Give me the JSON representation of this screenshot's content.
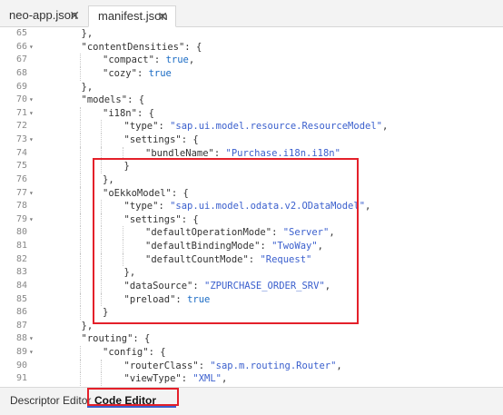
{
  "tabs": [
    {
      "label": "neo-app.json",
      "close": "✕"
    },
    {
      "label": "manifest.json",
      "close": "✕"
    }
  ],
  "lines": [
    {
      "n": "65",
      "fold": "",
      "indent": 1,
      "tokens": [
        [
          "p",
          "},"
        ]
      ]
    },
    {
      "n": "66",
      "fold": "▾",
      "indent": 1,
      "tokens": [
        [
          "k",
          "\"contentDensities\""
        ],
        [
          "p",
          ": {"
        ]
      ]
    },
    {
      "n": "67",
      "fold": "",
      "indent": 2,
      "tokens": [
        [
          "k",
          "\"compact\""
        ],
        [
          "p",
          ": "
        ],
        [
          "w",
          "true"
        ],
        [
          "p",
          ","
        ]
      ]
    },
    {
      "n": "68",
      "fold": "",
      "indent": 2,
      "tokens": [
        [
          "k",
          "\"cozy\""
        ],
        [
          "p",
          ": "
        ],
        [
          "w",
          "true"
        ]
      ]
    },
    {
      "n": "69",
      "fold": "",
      "indent": 1,
      "tokens": [
        [
          "p",
          "},"
        ]
      ]
    },
    {
      "n": "70",
      "fold": "▾",
      "indent": 1,
      "tokens": [
        [
          "k",
          "\"models\""
        ],
        [
          "p",
          ": {"
        ]
      ]
    },
    {
      "n": "71",
      "fold": "▾",
      "indent": 2,
      "tokens": [
        [
          "k",
          "\"i18n\""
        ],
        [
          "p",
          ": {"
        ]
      ]
    },
    {
      "n": "72",
      "fold": "",
      "indent": 3,
      "tokens": [
        [
          "k",
          "\"type\""
        ],
        [
          "p",
          ": "
        ],
        [
          "s",
          "\"sap.ui.model.resource.ResourceModel\""
        ],
        [
          "p",
          ","
        ]
      ]
    },
    {
      "n": "73",
      "fold": "▾",
      "indent": 3,
      "tokens": [
        [
          "k",
          "\"settings\""
        ],
        [
          "p",
          ": {"
        ]
      ]
    },
    {
      "n": "74",
      "fold": "",
      "indent": 4,
      "tokens": [
        [
          "k",
          "\"bundleName\""
        ],
        [
          "p",
          ": "
        ],
        [
          "s",
          "\"Purchase.i18n.i18n\""
        ]
      ]
    },
    {
      "n": "75",
      "fold": "",
      "indent": 3,
      "tokens": [
        [
          "p",
          "}"
        ]
      ]
    },
    {
      "n": "76",
      "fold": "",
      "indent": 2,
      "tokens": [
        [
          "p",
          "},"
        ]
      ]
    },
    {
      "n": "77",
      "fold": "▾",
      "indent": 2,
      "tokens": [
        [
          "k",
          "\"oEkkoModel\""
        ],
        [
          "p",
          ": {"
        ]
      ]
    },
    {
      "n": "78",
      "fold": "",
      "indent": 3,
      "tokens": [
        [
          "k",
          "\"type\""
        ],
        [
          "p",
          ": "
        ],
        [
          "s",
          "\"sap.ui.model.odata.v2.ODataModel\""
        ],
        [
          "p",
          ","
        ]
      ]
    },
    {
      "n": "79",
      "fold": "▾",
      "indent": 3,
      "tokens": [
        [
          "k",
          "\"settings\""
        ],
        [
          "p",
          ": {"
        ]
      ]
    },
    {
      "n": "80",
      "fold": "",
      "indent": 4,
      "tokens": [
        [
          "k",
          "\"defaultOperationMode\""
        ],
        [
          "p",
          ": "
        ],
        [
          "s",
          "\"Server\""
        ],
        [
          "p",
          ","
        ]
      ]
    },
    {
      "n": "81",
      "fold": "",
      "indent": 4,
      "tokens": [
        [
          "k",
          "\"defaultBindingMode\""
        ],
        [
          "p",
          ": "
        ],
        [
          "s",
          "\"TwoWay\""
        ],
        [
          "p",
          ","
        ]
      ]
    },
    {
      "n": "82",
      "fold": "",
      "indent": 4,
      "tokens": [
        [
          "k",
          "\"defaultCountMode\""
        ],
        [
          "p",
          ": "
        ],
        [
          "s",
          "\"Request\""
        ]
      ]
    },
    {
      "n": "83",
      "fold": "",
      "indent": 3,
      "tokens": [
        [
          "p",
          "},"
        ]
      ]
    },
    {
      "n": "84",
      "fold": "",
      "indent": 3,
      "tokens": [
        [
          "k",
          "\"dataSource\""
        ],
        [
          "p",
          ": "
        ],
        [
          "s",
          "\"ZPURCHASE_ORDER_SRV\""
        ],
        [
          "p",
          ","
        ]
      ]
    },
    {
      "n": "85",
      "fold": "",
      "indent": 3,
      "tokens": [
        [
          "k",
          "\"preload\""
        ],
        [
          "p",
          ": "
        ],
        [
          "w",
          "true"
        ]
      ]
    },
    {
      "n": "86",
      "fold": "",
      "indent": 2,
      "tokens": [
        [
          "p",
          "}"
        ]
      ]
    },
    {
      "n": "87",
      "fold": "",
      "indent": 1,
      "tokens": [
        [
          "p",
          "},"
        ]
      ]
    },
    {
      "n": "88",
      "fold": "▾",
      "indent": 1,
      "tokens": [
        [
          "k",
          "\"routing\""
        ],
        [
          "p",
          ": {"
        ]
      ]
    },
    {
      "n": "89",
      "fold": "▾",
      "indent": 2,
      "tokens": [
        [
          "k",
          "\"config\""
        ],
        [
          "p",
          ": {"
        ]
      ]
    },
    {
      "n": "90",
      "fold": "",
      "indent": 3,
      "tokens": [
        [
          "k",
          "\"routerClass\""
        ],
        [
          "p",
          ": "
        ],
        [
          "s",
          "\"sap.m.routing.Router\""
        ],
        [
          "p",
          ","
        ]
      ]
    },
    {
      "n": "91",
      "fold": "",
      "indent": 3,
      "tokens": [
        [
          "k",
          "\"viewType\""
        ],
        [
          "p",
          ": "
        ],
        [
          "s",
          "\"XML\""
        ],
        [
          "p",
          ","
        ]
      ]
    }
  ],
  "bottom_tabs": [
    {
      "label": "Descriptor Editor"
    },
    {
      "label": "Code Editor"
    }
  ]
}
